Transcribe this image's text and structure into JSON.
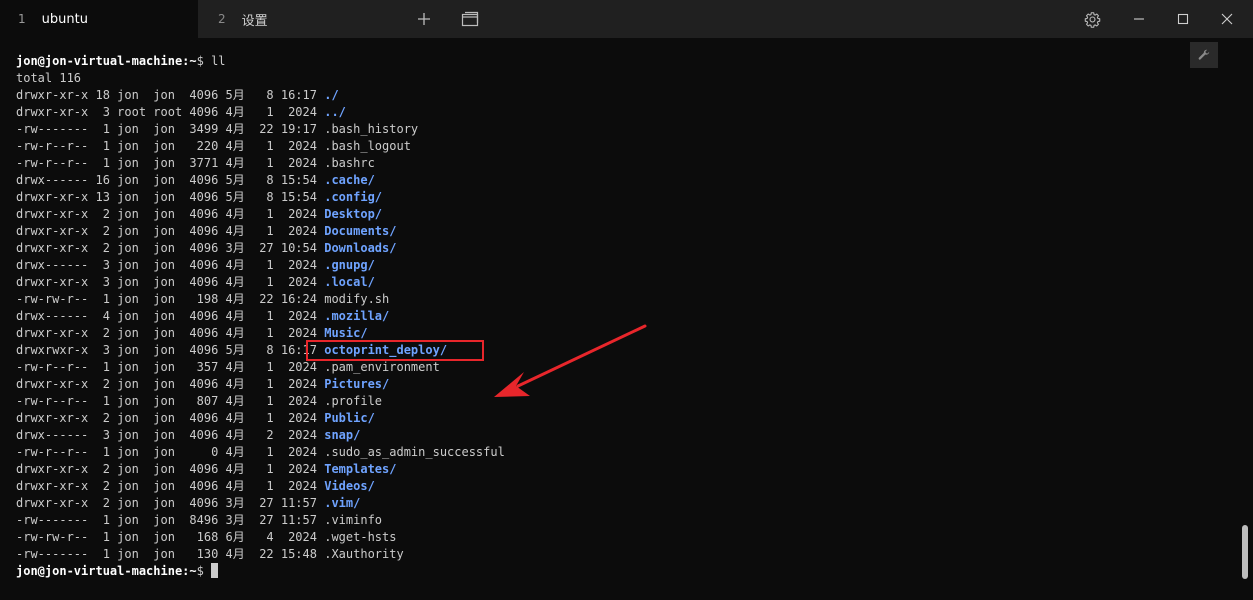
{
  "tabs": [
    {
      "number": "1",
      "label": "ubuntu",
      "active": true
    },
    {
      "number": "2",
      "label": "设置",
      "active": false
    }
  ],
  "titlebar": {
    "new_tab_glyph": "+",
    "icons": [
      "plus-icon",
      "tab-switcher-icon",
      "gear-icon",
      "minimize-icon",
      "maximize-icon",
      "close-icon"
    ]
  },
  "terminal": {
    "prompt_user": "jon@jon-virtual-machine",
    "prompt_path": ":~",
    "prompt_symbol": "$",
    "command": " ll",
    "total_line": "total 116",
    "entries": [
      {
        "meta": "drwxr-xr-x 18 jon  jon  4096 5月   8 16:17 ",
        "name": "./",
        "is_dir": true
      },
      {
        "meta": "drwxr-xr-x  3 root root 4096 4月   1  2024 ",
        "name": "../",
        "is_dir": true
      },
      {
        "meta": "-rw-------  1 jon  jon  3499 4月  22 19:17 ",
        "name": ".bash_history",
        "is_dir": false
      },
      {
        "meta": "-rw-r--r--  1 jon  jon   220 4月   1  2024 ",
        "name": ".bash_logout",
        "is_dir": false
      },
      {
        "meta": "-rw-r--r--  1 jon  jon  3771 4月   1  2024 ",
        "name": ".bashrc",
        "is_dir": false
      },
      {
        "meta": "drwx------ 16 jon  jon  4096 5月   8 15:54 ",
        "name": ".cache/",
        "is_dir": true
      },
      {
        "meta": "drwxr-xr-x 13 jon  jon  4096 5月   8 15:54 ",
        "name": ".config/",
        "is_dir": true
      },
      {
        "meta": "drwxr-xr-x  2 jon  jon  4096 4月   1  2024 ",
        "name": "Desktop/",
        "is_dir": true
      },
      {
        "meta": "drwxr-xr-x  2 jon  jon  4096 4月   1  2024 ",
        "name": "Documents/",
        "is_dir": true
      },
      {
        "meta": "drwxr-xr-x  2 jon  jon  4096 3月  27 10:54 ",
        "name": "Downloads/",
        "is_dir": true
      },
      {
        "meta": "drwx------  3 jon  jon  4096 4月   1  2024 ",
        "name": ".gnupg/",
        "is_dir": true
      },
      {
        "meta": "drwxr-xr-x  3 jon  jon  4096 4月   1  2024 ",
        "name": ".local/",
        "is_dir": true
      },
      {
        "meta": "-rw-rw-r--  1 jon  jon   198 4月  22 16:24 ",
        "name": "modify.sh",
        "is_dir": false
      },
      {
        "meta": "drwx------  4 jon  jon  4096 4月   1  2024 ",
        "name": ".mozilla/",
        "is_dir": true
      },
      {
        "meta": "drwxr-xr-x  2 jon  jon  4096 4月   1  2024 ",
        "name": "Music/",
        "is_dir": true
      },
      {
        "meta": "drwxrwxr-x  3 jon  jon  4096 5月   8 16:17 ",
        "name": "octoprint_deploy/",
        "is_dir": true
      },
      {
        "meta": "-rw-r--r--  1 jon  jon   357 4月   1  2024 ",
        "name": ".pam_environment",
        "is_dir": false
      },
      {
        "meta": "drwxr-xr-x  2 jon  jon  4096 4月   1  2024 ",
        "name": "Pictures/",
        "is_dir": true
      },
      {
        "meta": "-rw-r--r--  1 jon  jon   807 4月   1  2024 ",
        "name": ".profile",
        "is_dir": false
      },
      {
        "meta": "drwxr-xr-x  2 jon  jon  4096 4月   1  2024 ",
        "name": "Public/",
        "is_dir": true
      },
      {
        "meta": "drwx------  3 jon  jon  4096 4月   2  2024 ",
        "name": "snap/",
        "is_dir": true
      },
      {
        "meta": "-rw-r--r--  1 jon  jon     0 4月   1  2024 ",
        "name": ".sudo_as_admin_successful",
        "is_dir": false
      },
      {
        "meta": "drwxr-xr-x  2 jon  jon  4096 4月   1  2024 ",
        "name": "Templates/",
        "is_dir": true
      },
      {
        "meta": "drwxr-xr-x  2 jon  jon  4096 4月   1  2024 ",
        "name": "Videos/",
        "is_dir": true
      },
      {
        "meta": "drwxr-xr-x  2 jon  jon  4096 3月  27 11:57 ",
        "name": ".vim/",
        "is_dir": true
      },
      {
        "meta": "-rw-------  1 jon  jon  8496 3月  27 11:57 ",
        "name": ".viminfo",
        "is_dir": false
      },
      {
        "meta": "-rw-rw-r--  1 jon  jon   168 6月   4  2024 ",
        "name": ".wget-hsts",
        "is_dir": false
      },
      {
        "meta": "-rw-------  1 jon  jon   130 4月  22 15:48 ",
        "name": ".Xauthority",
        "is_dir": false
      }
    ],
    "end_prompt_user": "jon@jon-virtual-machine",
    "end_prompt_path": ":~",
    "end_prompt_symbol": "$ "
  },
  "annotation": {
    "color": "#e8262b",
    "highlighted_entry": "octoprint_deploy/"
  },
  "colors": {
    "background": "#0c0c0c",
    "titlebar": "#202020",
    "text": "#cccccc",
    "directory": "#6fa3ff"
  }
}
